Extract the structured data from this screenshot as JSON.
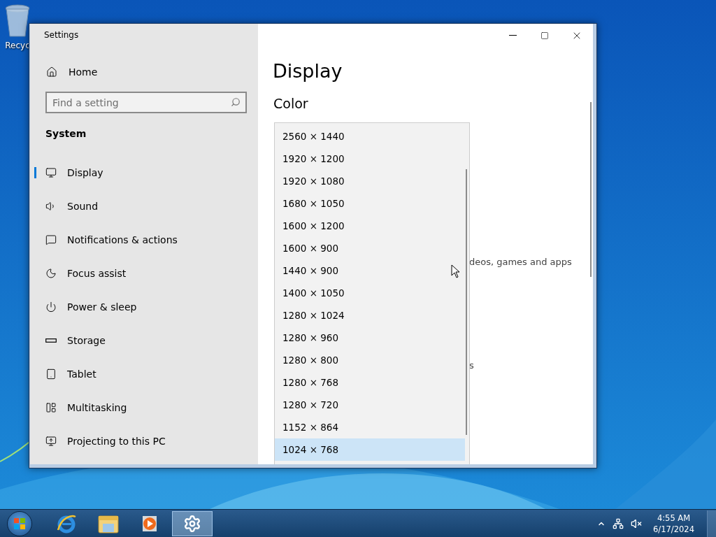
{
  "desktop": {
    "icons": [
      {
        "kind": "recycle",
        "label": "Recyc"
      }
    ]
  },
  "window": {
    "title": "Settings"
  },
  "sidebar": {
    "home": "Home",
    "search": {
      "placeholder": "Find a setting"
    },
    "section": "System",
    "items": [
      {
        "kind": "display",
        "label": "Display",
        "selected": true
      },
      {
        "kind": "sound",
        "label": "Sound",
        "selected": false
      },
      {
        "kind": "notifications",
        "label": "Notifications & actions",
        "selected": false
      },
      {
        "kind": "focus",
        "label": "Focus assist",
        "selected": false
      },
      {
        "kind": "power",
        "label": "Power & sleep",
        "selected": false
      },
      {
        "kind": "storage",
        "label": "Storage",
        "selected": false
      },
      {
        "kind": "tablet",
        "label": "Tablet",
        "selected": false
      },
      {
        "kind": "multitasking",
        "label": "Multitasking",
        "selected": false
      },
      {
        "kind": "projecting",
        "label": "Projecting to this PC",
        "selected": false
      }
    ]
  },
  "content": {
    "title": "Display",
    "section": "Color",
    "hidden_texts": [
      "deos, games and apps",
      "s"
    ]
  },
  "dropdown": {
    "options": [
      {
        "label": "2560 × 1440",
        "selected": false
      },
      {
        "label": "1920 × 1200",
        "selected": false
      },
      {
        "label": "1920 × 1080",
        "selected": false
      },
      {
        "label": "1680 × 1050",
        "selected": false
      },
      {
        "label": "1600 × 1200",
        "selected": false
      },
      {
        "label": "1600 × 900",
        "selected": false
      },
      {
        "label": "1440 × 900",
        "selected": false
      },
      {
        "label": "1400 × 1050",
        "selected": false
      },
      {
        "label": "1280 × 1024",
        "selected": false
      },
      {
        "label": "1280 × 960",
        "selected": false
      },
      {
        "label": "1280 × 800",
        "selected": false
      },
      {
        "label": "1280 × 768",
        "selected": false
      },
      {
        "label": "1280 × 720",
        "selected": false
      },
      {
        "label": "1152 × 864",
        "selected": false
      },
      {
        "label": "1024 × 768",
        "selected": true
      }
    ]
  },
  "taskbar": {
    "apps": [
      {
        "kind": "browser",
        "active": false
      },
      {
        "kind": "explorer",
        "active": false
      },
      {
        "kind": "media",
        "active": false
      },
      {
        "kind": "settings",
        "active": true
      }
    ],
    "clock": {
      "time": "4:55 AM",
      "date": "6/17/2024"
    }
  }
}
